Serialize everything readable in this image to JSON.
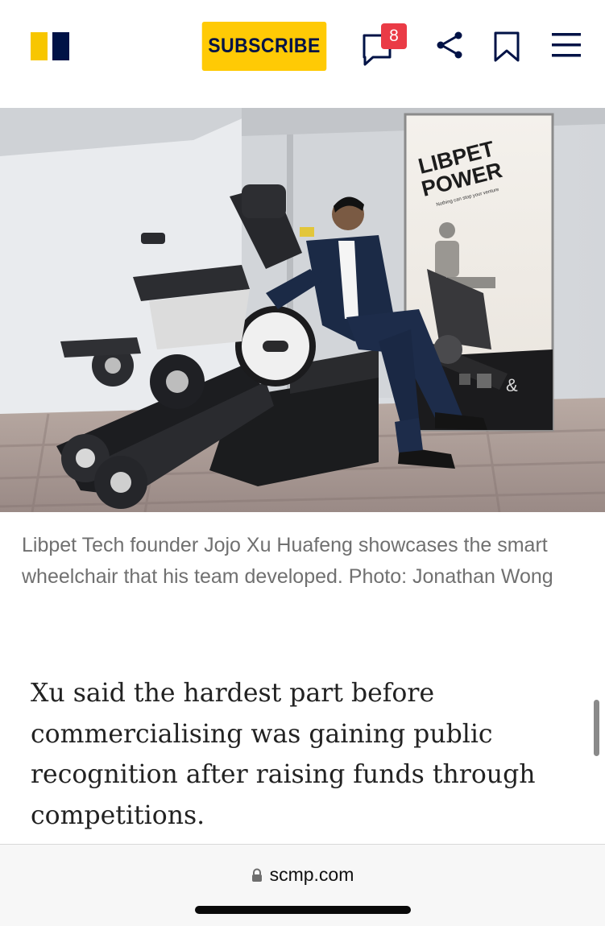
{
  "header": {
    "subscribe_label": "SUBSCRIBE",
    "comment_count": "8",
    "icons": [
      "comments-icon",
      "share-icon",
      "bookmark-icon",
      "menu-icon"
    ]
  },
  "photo": {
    "poster_line1": "LIBPET",
    "poster_line2": "POWER",
    "poster_tagline": "Nothing can stop your venture"
  },
  "caption": "Libpet Tech founder Jojo Xu Huafeng showcases the smart wheelchair that his team developed. Photo: Jonathan Wong",
  "body": {
    "paragraph": "Xu said the hardest part before commercialising was gaining public recognition after raising funds through competitions."
  },
  "browser": {
    "url": "scmp.com"
  },
  "colors": {
    "brand_yellow": "#ffca05",
    "brand_navy": "#001246",
    "badge_red": "#ea3b46"
  }
}
